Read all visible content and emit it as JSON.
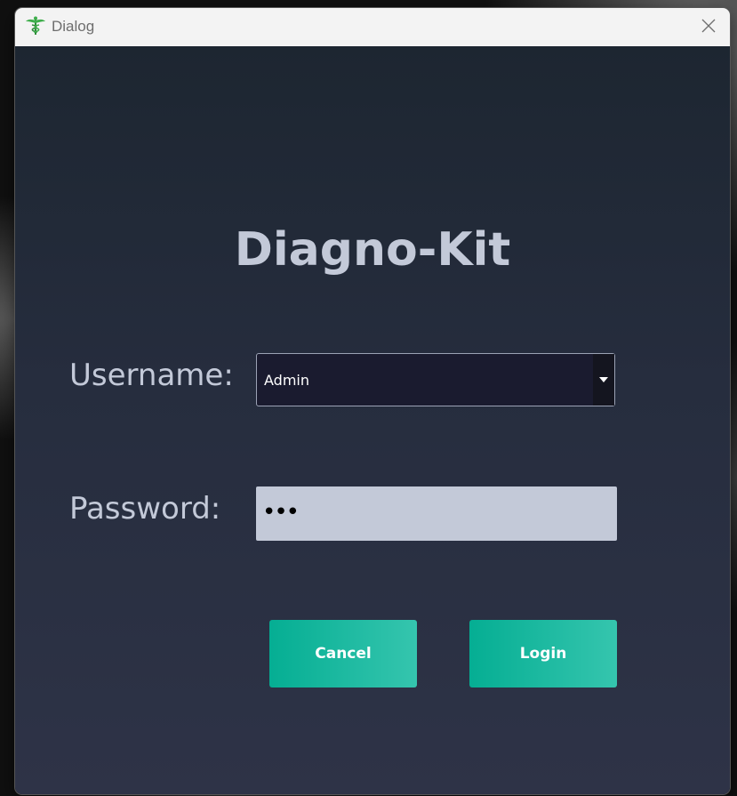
{
  "window": {
    "title": "Dialog",
    "icon": "caduceus-icon"
  },
  "form": {
    "heading": "Diagno-Kit",
    "username_label": "Username:",
    "username_value": "Admin",
    "password_label": "Password:",
    "password_mask": "•••",
    "cancel_label": "Cancel",
    "login_label": "Login"
  },
  "colors": {
    "accent": "#05ae93",
    "text": "#c3c9d8",
    "background": "#262d3e"
  }
}
